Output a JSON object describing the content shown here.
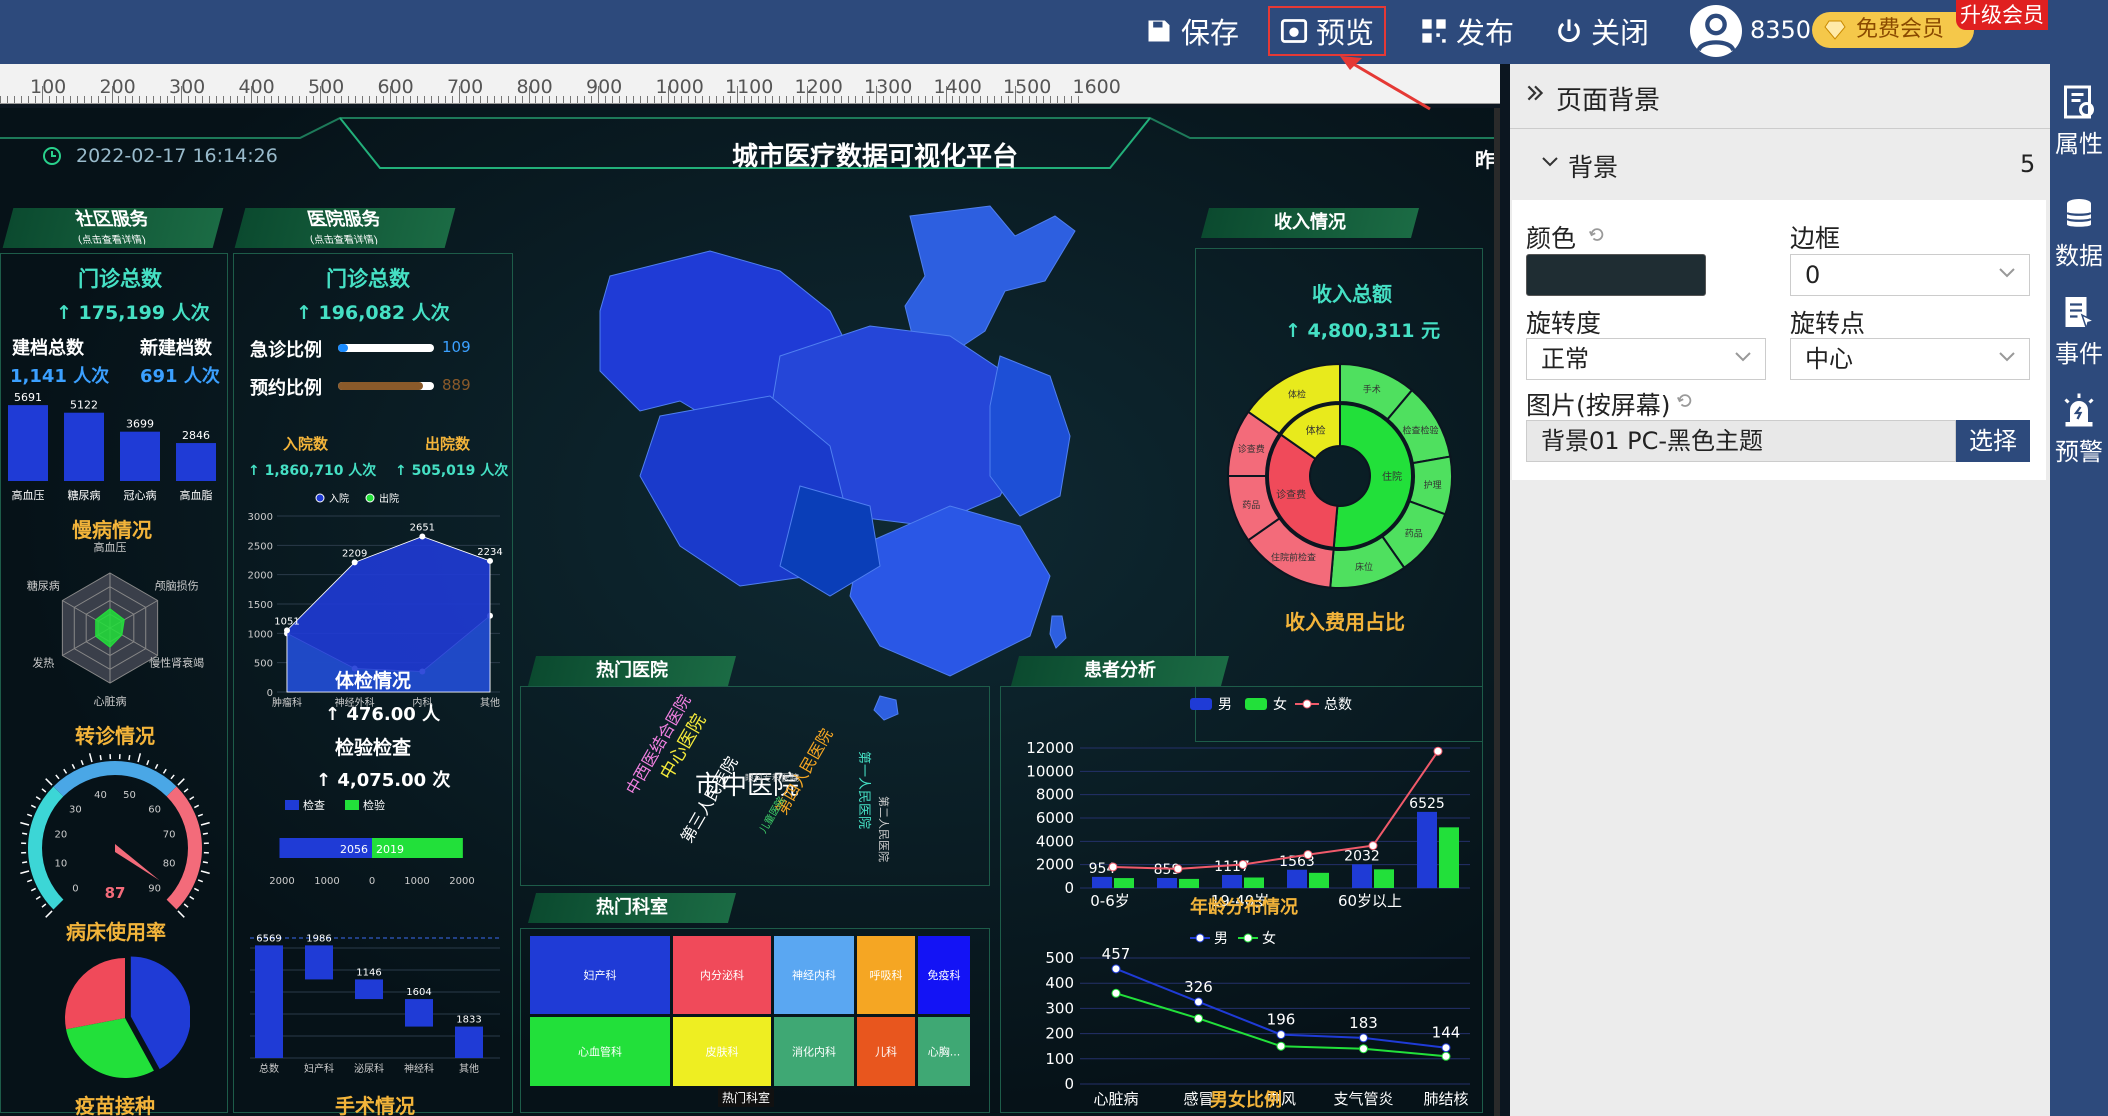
{
  "topbar": {
    "save": "保存",
    "preview": "预览",
    "publish": "发布",
    "close": "关闭",
    "user_count": "8350",
    "member": "免费会员",
    "upgrade": "升级会员"
  },
  "ruler": {
    "ticks": [
      "100",
      "200",
      "300",
      "400",
      "500",
      "600",
      "700",
      "800",
      "900",
      "1000",
      "1100",
      "1200",
      "1300",
      "1400",
      "1500",
      "1600"
    ]
  },
  "dashboard": {
    "datetime": "2022-02-17 16:14:26",
    "title": "城市医疗数据可视化平台",
    "title_right": "昨",
    "community": {
      "header": "社区服务",
      "sub": "(点击查看详情)",
      "visit_title": "门诊总数",
      "visit_value": "↑ 175,199 人次",
      "archive_label": "建档总数",
      "archive_value": "1,141 人次",
      "new_archive_label": "新建档数",
      "new_archive_value": "691 人次"
    },
    "chronic": {
      "title": "慢病情况"
    },
    "referral": {
      "title": "转诊情况"
    },
    "bed": {
      "title": "病床使用率"
    },
    "vaccine": {
      "title": "疫苗接种"
    },
    "hospital_service": {
      "header": "医院服务",
      "sub": "(点击查看详情)",
      "visit_title": "门诊总数",
      "visit_value": "↑ 196,082 人次",
      "emergency_label": "急诊比例",
      "emergency_value": "109",
      "appoint_label": "预约比例",
      "appoint_value": "889",
      "in_title": "入院数",
      "in_value": "↑ 1,860,710 人次",
      "out_title": "出院数",
      "out_value": "↑ 505,019 人次"
    },
    "physical": {
      "title": "体检情况",
      "value": "↑ 476.00 人",
      "check_title": "检验检查",
      "check_value": "↑ 4,075.00 次"
    },
    "surgery": {
      "title": "手术情况"
    },
    "income": {
      "header": "收入情况",
      "total_title": "收入总额",
      "total_value": "↑ 4,800,311 元",
      "ratio_title": "收入费用占比"
    },
    "hot_hospital": {
      "header": "热门医院"
    },
    "hot_dept": {
      "header": "热门科室",
      "footer": "热门科室"
    },
    "patient": {
      "header": "患者分析",
      "age_title": "年龄分布情况",
      "gender_title": "男女比例"
    }
  },
  "panel": {
    "title": "页面背景",
    "section": "背景",
    "section_count": "5",
    "color_label": "颜色",
    "color_value": "#1f2d33",
    "border_label": "边框",
    "border_value": "0",
    "rotate_label": "旋转度",
    "rotate_value": "正常",
    "pivot_label": "旋转点",
    "pivot_value": "中心",
    "image_label": "图片(按屏幕)",
    "image_value": "背景01 PC-黑色主题",
    "choose": "选择"
  },
  "rightbar": {
    "attr": "属性",
    "data": "数据",
    "event": "事件",
    "alert": "预警"
  },
  "chart_data": [
    {
      "id": "chronic_bar",
      "type": "bar",
      "categories": [
        "高血压",
        "糖尿病",
        "冠心病",
        "高血脂"
      ],
      "values": [
        5691,
        5122,
        3699,
        2846
      ]
    },
    {
      "id": "chronic_radar",
      "type": "radar",
      "categories": [
        "高血压",
        "颅脑损伤",
        "慢性肾衰竭",
        "心脏病",
        "发热",
        "糖尿病"
      ],
      "values": [
        0.35,
        0.3,
        0.25,
        0.35,
        0.3,
        0.3
      ]
    },
    {
      "id": "gauge",
      "type": "gauge",
      "value": 87,
      "min": 0,
      "max": 90,
      "ticks": [
        0,
        10,
        20,
        30,
        40,
        50,
        60,
        70,
        80,
        90
      ]
    },
    {
      "id": "vaccine_pie",
      "type": "pie",
      "values": [
        42,
        30,
        28
      ],
      "colors": [
        "#1f3bd6",
        "#22e03a",
        "#f04a5a"
      ]
    },
    {
      "id": "in_out",
      "type": "area",
      "categories": [
        "肿瘤科",
        "神经外科",
        "内科",
        "其他"
      ],
      "series": [
        {
          "name": "入院",
          "values": [
            1051,
            2209,
            2651,
            2234
          ]
        },
        {
          "name": "出院",
          "values": [
            1000,
            400,
            350,
            1300
          ]
        }
      ],
      "ylim": [
        0,
        3000
      ],
      "yticks": [
        0,
        500,
        1000,
        1500,
        2000,
        2500,
        3000
      ]
    },
    {
      "id": "check_bar",
      "type": "bar",
      "series": [
        {
          "name": "检查",
          "values": [
            2056
          ]
        },
        {
          "name": "检验",
          "values": [
            2019
          ]
        }
      ],
      "xticks": [
        "2000",
        "1000",
        "0",
        "1000",
        "2000"
      ]
    },
    {
      "id": "surgery_waterfall",
      "type": "bar",
      "categories": [
        "总数",
        "妇产科",
        "泌尿科",
        "神经科",
        "其他"
      ],
      "values": [
        6569,
        1986,
        1146,
        1604,
        1833
      ]
    },
    {
      "id": "income_sunburst",
      "type": "pie",
      "inner": [
        {
          "label": "诊查费",
          "color": "#f04a5a"
        },
        {
          "label": "住院",
          "color": "#22e03a"
        },
        {
          "label": "体检",
          "color": "#e8ea1c"
        }
      ],
      "outer": [
        "手术",
        "检查检验",
        "护理",
        "药品",
        "床位",
        "住院前检查",
        "药品",
        "诊查费",
        "体检"
      ]
    },
    {
      "id": "age_chart",
      "type": "bar",
      "categories": [
        "0-6岁",
        "",
        "19-40岁",
        "",
        "60岁以上",
        ""
      ],
      "series": [
        {
          "name": "男",
          "values": [
            954,
            859,
            1117,
            1563,
            2032,
            6525
          ]
        },
        {
          "name": "女",
          "values": [
            850,
            780,
            900,
            1300,
            1600,
            5200
          ]
        },
        {
          "name": "总数",
          "values": [
            1804,
            1639,
            2017,
            2863,
            3632,
            11725
          ]
        }
      ],
      "ylim": [
        0,
        12000
      ],
      "yticks": [
        0,
        2000,
        4000,
        6000,
        8000,
        10000,
        12000
      ]
    },
    {
      "id": "gender_chart",
      "type": "line",
      "categories": [
        "心脏病",
        "感冒",
        "中风",
        "支气管炎",
        "肺结核"
      ],
      "series": [
        {
          "name": "男",
          "values": [
            457,
            326,
            196,
            183,
            144
          ]
        },
        {
          "name": "女",
          "values": [
            360,
            260,
            150,
            140,
            110
          ]
        }
      ],
      "ylim": [
        0,
        500
      ],
      "yticks": [
        0,
        100,
        200,
        300,
        400,
        500
      ]
    },
    {
      "id": "dept_treemap",
      "type": "heatmap",
      "cells": [
        {
          "label": "妇产科",
          "color": "#1f3bd6"
        },
        {
          "label": "内分泌科",
          "color": "#f04a5a"
        },
        {
          "label": "神经内科",
          "color": "#5aa7f2"
        },
        {
          "label": "呼吸科",
          "color": "#f5a623"
        },
        {
          "label": "免疫科",
          "color": "#1313f5"
        },
        {
          "label": "心血管科",
          "color": "#22e03a"
        },
        {
          "label": "皮肤科",
          "color": "#eeee22"
        },
        {
          "label": "消化内科",
          "color": "#3fa874"
        },
        {
          "label": "儿科",
          "color": "#e8561e"
        },
        {
          "label": "心胸...",
          "color": "#3fa874"
        }
      ]
    }
  ],
  "wordcloud": [
    "市中医院",
    "中心医院",
    "中西医结合医院",
    "第三人民医院",
    "第四人民医院",
    "第一人民医院",
    "第二人民医院",
    "眼科专科医院",
    "儿童医院"
  ]
}
